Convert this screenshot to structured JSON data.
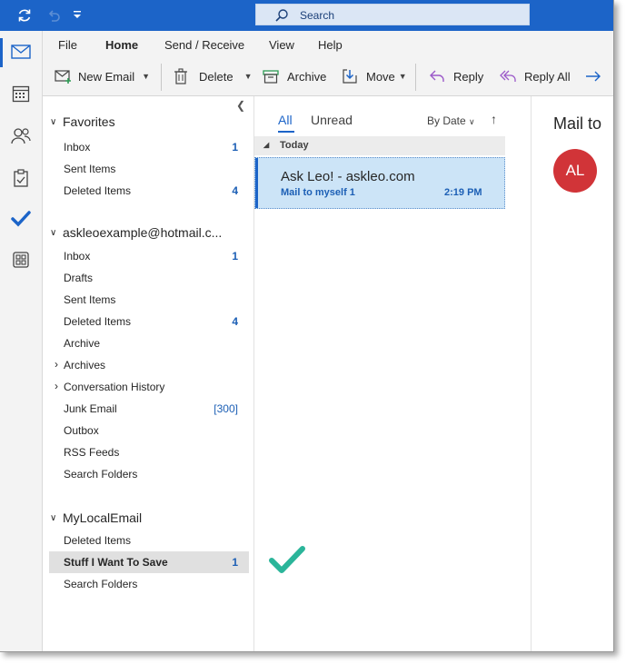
{
  "titlebar": {
    "search_label": "Search",
    "icons": [
      "sync-icon",
      "undo-icon",
      "customize-icon",
      "search-icon"
    ]
  },
  "rail": {
    "icons": [
      "mail-icon",
      "calendar-icon",
      "people-icon",
      "tasks-icon",
      "todo-check-icon",
      "apps-icon"
    ]
  },
  "menu": [
    "File",
    "Home",
    "Send / Receive",
    "View",
    "Help"
  ],
  "toolbar": {
    "new_email": "New Email",
    "delete": "Delete",
    "archive": "Archive",
    "move": "Move",
    "reply": "Reply",
    "reply_all": "Reply All"
  },
  "folders": {
    "favorites": {
      "title": "Favorites",
      "items": [
        {
          "label": "Inbox",
          "count": "1"
        },
        {
          "label": "Sent Items",
          "count": ""
        },
        {
          "label": "Deleted Items",
          "count": "4"
        }
      ]
    },
    "account": {
      "title": "askleoexample@hotmail.c...",
      "items": [
        {
          "label": "Inbox",
          "count": "1"
        },
        {
          "label": "Drafts",
          "count": ""
        },
        {
          "label": "Sent Items",
          "count": ""
        },
        {
          "label": "Deleted Items",
          "count": "4"
        },
        {
          "label": "Archive",
          "count": ""
        },
        {
          "label": "Archives",
          "count": ""
        },
        {
          "label": "Conversation History",
          "count": ""
        },
        {
          "label": "Junk Email",
          "count": "[300]"
        },
        {
          "label": "Outbox",
          "count": ""
        },
        {
          "label": "RSS Feeds",
          "count": ""
        },
        {
          "label": "Search Folders",
          "count": ""
        }
      ]
    },
    "local": {
      "title": "MyLocalEmail",
      "items": [
        {
          "label": "Deleted Items",
          "count": ""
        },
        {
          "label": "Stuff I Want To Save",
          "count": "1"
        },
        {
          "label": "Search Folders",
          "count": ""
        }
      ]
    }
  },
  "list": {
    "tab_all": "All",
    "tab_unread": "Unread",
    "sort": "By Date",
    "group": "Today",
    "message": {
      "sender": "Ask Leo! - askleo.com",
      "subject": "Mail to myself 1",
      "time": "2:19 PM"
    }
  },
  "reading": {
    "title": "Mail to",
    "avatar_initials": "AL"
  },
  "colors": {
    "accent": "#1c64c8",
    "selection": "#cce4f7",
    "avatar": "#d13438",
    "checkmark": "#2bb59a"
  }
}
